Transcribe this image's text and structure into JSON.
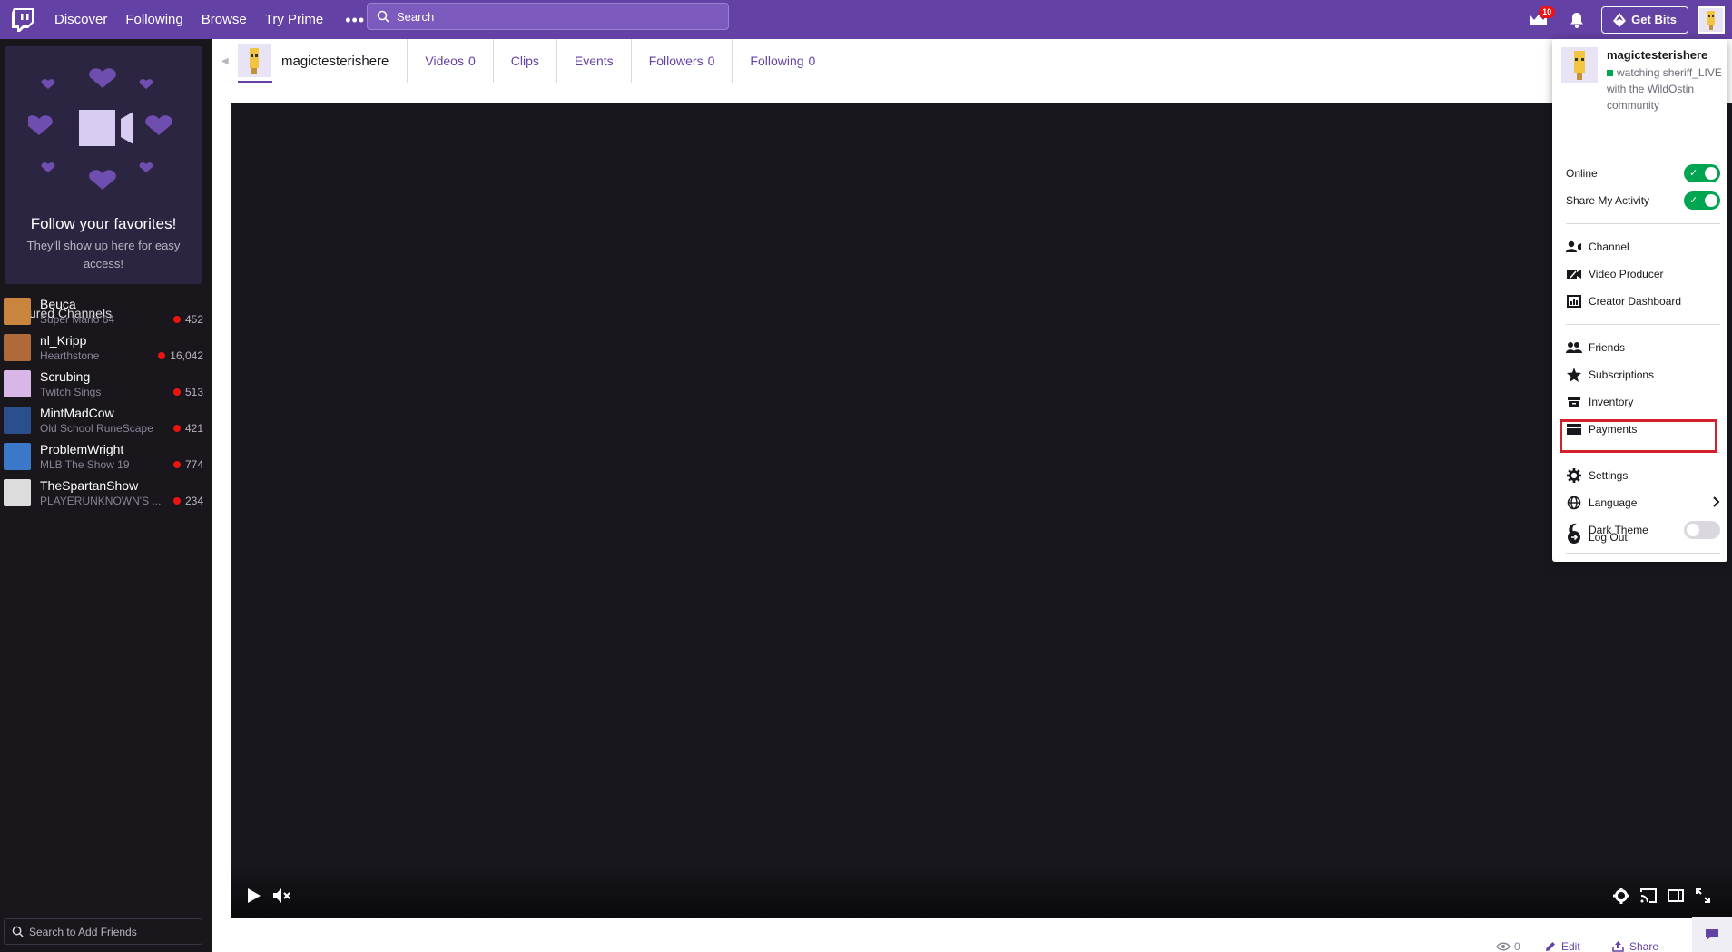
{
  "topnav": {
    "links": [
      "Discover",
      "Following",
      "Browse",
      "Try Prime"
    ],
    "more_label": "•••",
    "search_placeholder": "Search",
    "notification_count": "10",
    "get_bits_label": "Get Bits",
    "brand_color": "#6441a4"
  },
  "sidebar": {
    "follow_title": "Follow your favorites!",
    "follow_subtitle": "They'll show up here for easy access!",
    "featured_title": "Featured Channels",
    "channels": [
      {
        "name": "Beuca",
        "game": "Super Mario 64",
        "viewers": "452",
        "color": "#c9843e"
      },
      {
        "name": "nl_Kripp",
        "game": "Hearthstone",
        "viewers": "16,042",
        "color": "#b06a3a"
      },
      {
        "name": "Scrubing",
        "game": "Twitch Sings",
        "viewers": "513",
        "color": "#d8b7e8"
      },
      {
        "name": "MintMadCow",
        "game": "Old School RuneScape",
        "viewers": "421",
        "color": "#2b4f8c"
      },
      {
        "name": "ProblemWright",
        "game": "MLB The Show 19",
        "viewers": "774",
        "color": "#3c78c8"
      },
      {
        "name": "TheSpartanShow",
        "game": "PLAYERUNKNOWN'S ...",
        "viewers": "234",
        "color": "#dcdcdc"
      }
    ],
    "friend_search_placeholder": "Search to Add Friends"
  },
  "channel_tabs": {
    "username": "magictesterishere",
    "tabs": [
      {
        "label": "Videos",
        "count": "0"
      },
      {
        "label": "Clips",
        "count": ""
      },
      {
        "label": "Events",
        "count": ""
      },
      {
        "label": "Followers",
        "count": "0"
      },
      {
        "label": "Following",
        "count": "0"
      }
    ]
  },
  "below_video": {
    "views": "0",
    "edit_label": "Edit",
    "share_label": "Share"
  },
  "menu": {
    "username": "magictesterishere",
    "status": "watching sheriff_LIVE with the WildOstin community",
    "online_label": "Online",
    "share_activity_label": "Share My Activity",
    "items_group1": [
      "Channel",
      "Video Producer",
      "Creator Dashboard"
    ],
    "items_group2": [
      "Friends",
      "Subscriptions",
      "Inventory",
      "Payments"
    ],
    "settings_label": "Settings",
    "language_label": "Language",
    "dark_theme_label": "Dark Theme",
    "logout_label": "Log Out",
    "toggle_on_color": "#00a551",
    "highlight_color": "#d3212c"
  }
}
